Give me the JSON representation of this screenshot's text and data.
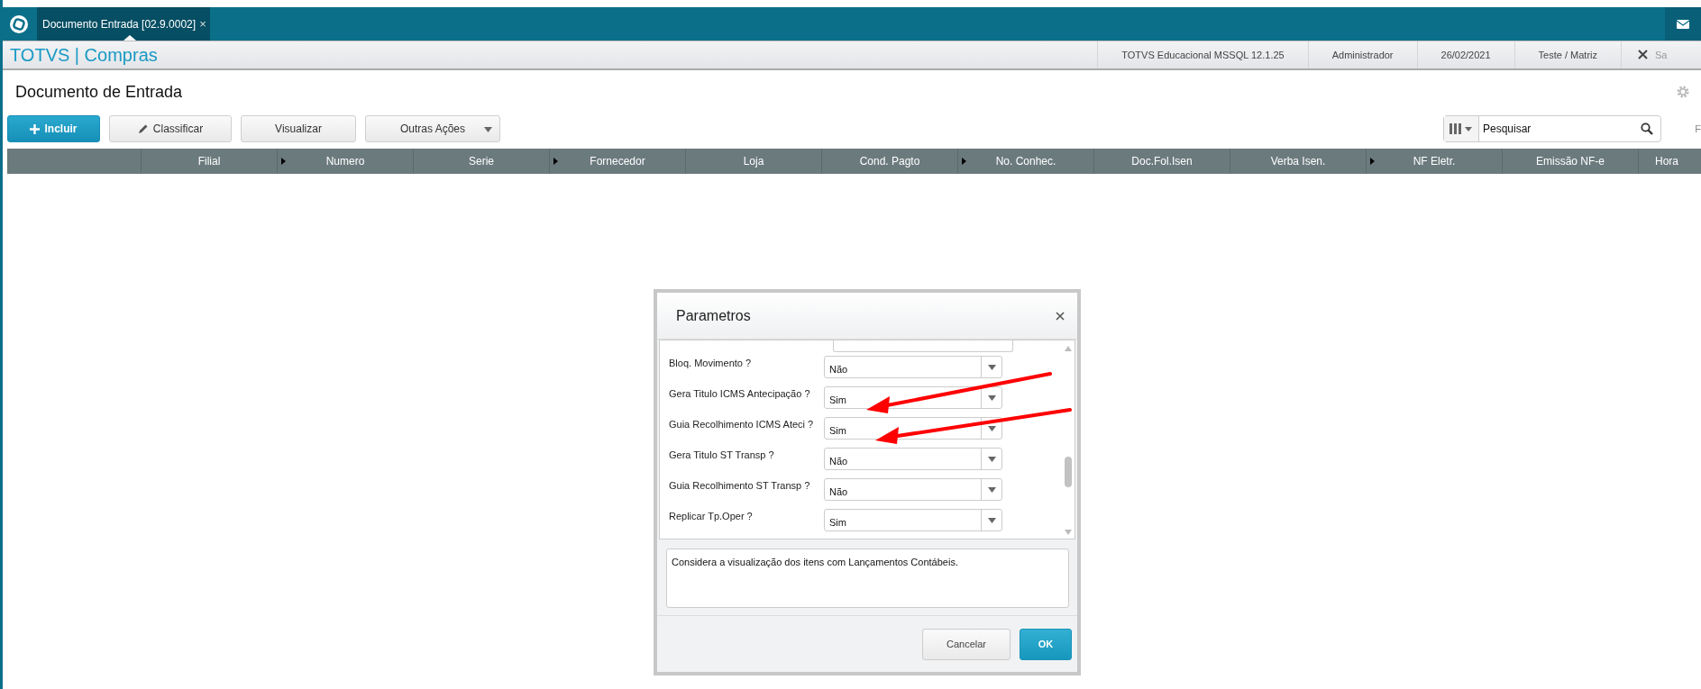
{
  "tabs": [
    {
      "label": "Documento Entrada [02.9.0002]",
      "close": "×",
      "selected": true
    }
  ],
  "header": {
    "brand": "TOTVS | Compras",
    "info": [
      "TOTVS Educacional MSSQL 12.1.25",
      "Administrador",
      "26/02/2021",
      "Teste / Matriz"
    ],
    "exit_label": "Sa"
  },
  "page": {
    "title": "Documento de Entrada"
  },
  "toolbar": {
    "buttons": [
      {
        "label": "Incluir",
        "kind": "primary"
      },
      {
        "label": "Classificar",
        "kind": "edit"
      },
      {
        "label": "Visualizar",
        "kind": "plain"
      },
      {
        "label": "Outras Ações",
        "kind": "dropdown"
      }
    ],
    "search": {
      "placeholder": "Pesquisar"
    },
    "cut_label": "F"
  },
  "table": {
    "columns": [
      {
        "marker": false
      },
      {
        "label": "Filial",
        "marker": false
      },
      {
        "label": "Numero",
        "marker": true
      },
      {
        "label": "Serie",
        "marker": false
      },
      {
        "label": "Fornecedor",
        "marker": true
      },
      {
        "label": "Loja",
        "marker": false
      },
      {
        "label": "Cond. Pagto",
        "marker": false
      },
      {
        "label": "No. Conhec.",
        "marker": true
      },
      {
        "label": "Doc.Fol.Isen",
        "marker": false
      },
      {
        "label": "Verba Isen.",
        "marker": false
      },
      {
        "label": "NF Eletr.",
        "marker": true
      },
      {
        "label": "Emissão NF-e",
        "marker": false
      },
      {
        "label": "Hora",
        "marker": false
      }
    ]
  },
  "dialog": {
    "title": "Parametros",
    "params": [
      {
        "label": "Bloq. Movimento ?",
        "value": "Não",
        "highlighted": false
      },
      {
        "label": "Gera Titulo ICMS Antecipação ?",
        "value": "Sim",
        "highlighted": true
      },
      {
        "label": "Guia Recolhimento ICMS Ateci ?",
        "value": "Sim",
        "highlighted": true
      },
      {
        "label": "Gera Titulo ST Transp ?",
        "value": "Não",
        "highlighted": false
      },
      {
        "label": "Guia Recolhimento ST Transp ?",
        "value": "Não",
        "highlighted": false
      },
      {
        "label": "Replicar Tp.Oper ?",
        "value": "Sim",
        "highlighted": false
      }
    ],
    "description": "Considera a visualização dos itens com  Lançamentos Contábeis.",
    "buttons": [
      {
        "label": "Cancelar",
        "kind": "secondary"
      },
      {
        "label": "OK",
        "kind": "primary"
      }
    ]
  }
}
